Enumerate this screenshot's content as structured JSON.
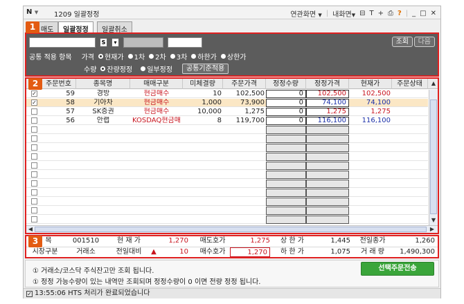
{
  "window": {
    "menu_label": "N",
    "title": "1209 일괄정정",
    "links": [
      "연관화면",
      "내화면",
      "T",
      "+"
    ],
    "help": "?"
  },
  "tabs": [
    {
      "label": "매도",
      "active": false
    },
    {
      "label": "일괄정정",
      "active": true
    },
    {
      "label": "일괄취소",
      "active": false
    }
  ],
  "badges": [
    "1",
    "2",
    "3"
  ],
  "panel1": {
    "account_suffix": "S",
    "query_button": "조회",
    "next_button": "다음",
    "apply_label": "공통 적용 항목",
    "price_label": "가격",
    "price_options": [
      "현재가",
      "1차",
      "2차",
      "3차",
      "하한가",
      "상한가"
    ],
    "price_selected": "현재가",
    "qty_label": "수량",
    "qty_options": [
      "잔량정정",
      "일부정정"
    ],
    "qty_selected": "잔량정정",
    "apply_button": "공통기준적용"
  },
  "grid": {
    "columns": [
      "주문번호",
      "종목명",
      "매매구분",
      "미체결량",
      "주문가격",
      "정정수량",
      "정정가격",
      "현재가",
      "주문상태"
    ],
    "rows": [
      {
        "checked": true,
        "order_no": "59",
        "name": "경방",
        "type": "현금매수",
        "unfilled": "10",
        "price": "102,500",
        "mod_qty": "0",
        "mod_price": "102,500",
        "current": "102,500",
        "status": "",
        "highlight": false,
        "price_color": "red"
      },
      {
        "checked": true,
        "order_no": "58",
        "name": "기아차",
        "type": "현금매수",
        "unfilled": "1,000",
        "price": "73,900",
        "mod_qty": "0",
        "mod_price": "74,100",
        "current": "74,100",
        "status": "",
        "highlight": true,
        "price_color": "blue"
      },
      {
        "checked": false,
        "order_no": "57",
        "name": "SK증권",
        "type": "현금매수",
        "unfilled": "10,000",
        "price": "1,275",
        "mod_qty": "0",
        "mod_price": "1,275",
        "current": "1,275",
        "status": "",
        "highlight": false,
        "price_color": "red"
      },
      {
        "checked": false,
        "order_no": "56",
        "name": "안랩",
        "type": "KOSDAQ현금매",
        "unfilled": "8",
        "price": "119,700",
        "mod_qty": "0",
        "mod_price": "116,100",
        "current": "116,100",
        "status": "",
        "highlight": false,
        "price_color": "blue"
      }
    ],
    "empty_rows": 11
  },
  "info": {
    "row1": {
      "stock_label": "목",
      "stock_code": "001510",
      "current_label": "현 재 가",
      "current": "1,270",
      "ask_label": "매도호가",
      "ask": "1,275",
      "upper_label": "상 한 가",
      "upper": "1,445",
      "prev_label": "전일종가",
      "prev": "1,260"
    },
    "row2": {
      "market_label": "시장구분",
      "market": "거래소",
      "change_label": "전일대비",
      "change_arrow": "▲",
      "change": "10",
      "bid_label": "매수호가",
      "bid": "1,270",
      "lower_label": "하 한 가",
      "lower": "1,075",
      "volume_label": "거 래 량",
      "volume": "1,490,300"
    }
  },
  "notes": {
    "line1": "① 거래소/코스닥 주식잔고만 조회 됩니다.",
    "line2": "① 정정 가능수량이 있는 내역만 조회되며 정정수량이 0 이면 전량 정정 됩니다.",
    "send_button": "선택주문전송"
  },
  "status_bar": {
    "text": "13:55:06  HTS 처리가 완료되었습니다"
  },
  "colors": {
    "accent_badge": "#e35b12",
    "highlight_border": "#e02020",
    "send_button": "#3aa53a",
    "panel_bg": "#5c5c5c"
  }
}
